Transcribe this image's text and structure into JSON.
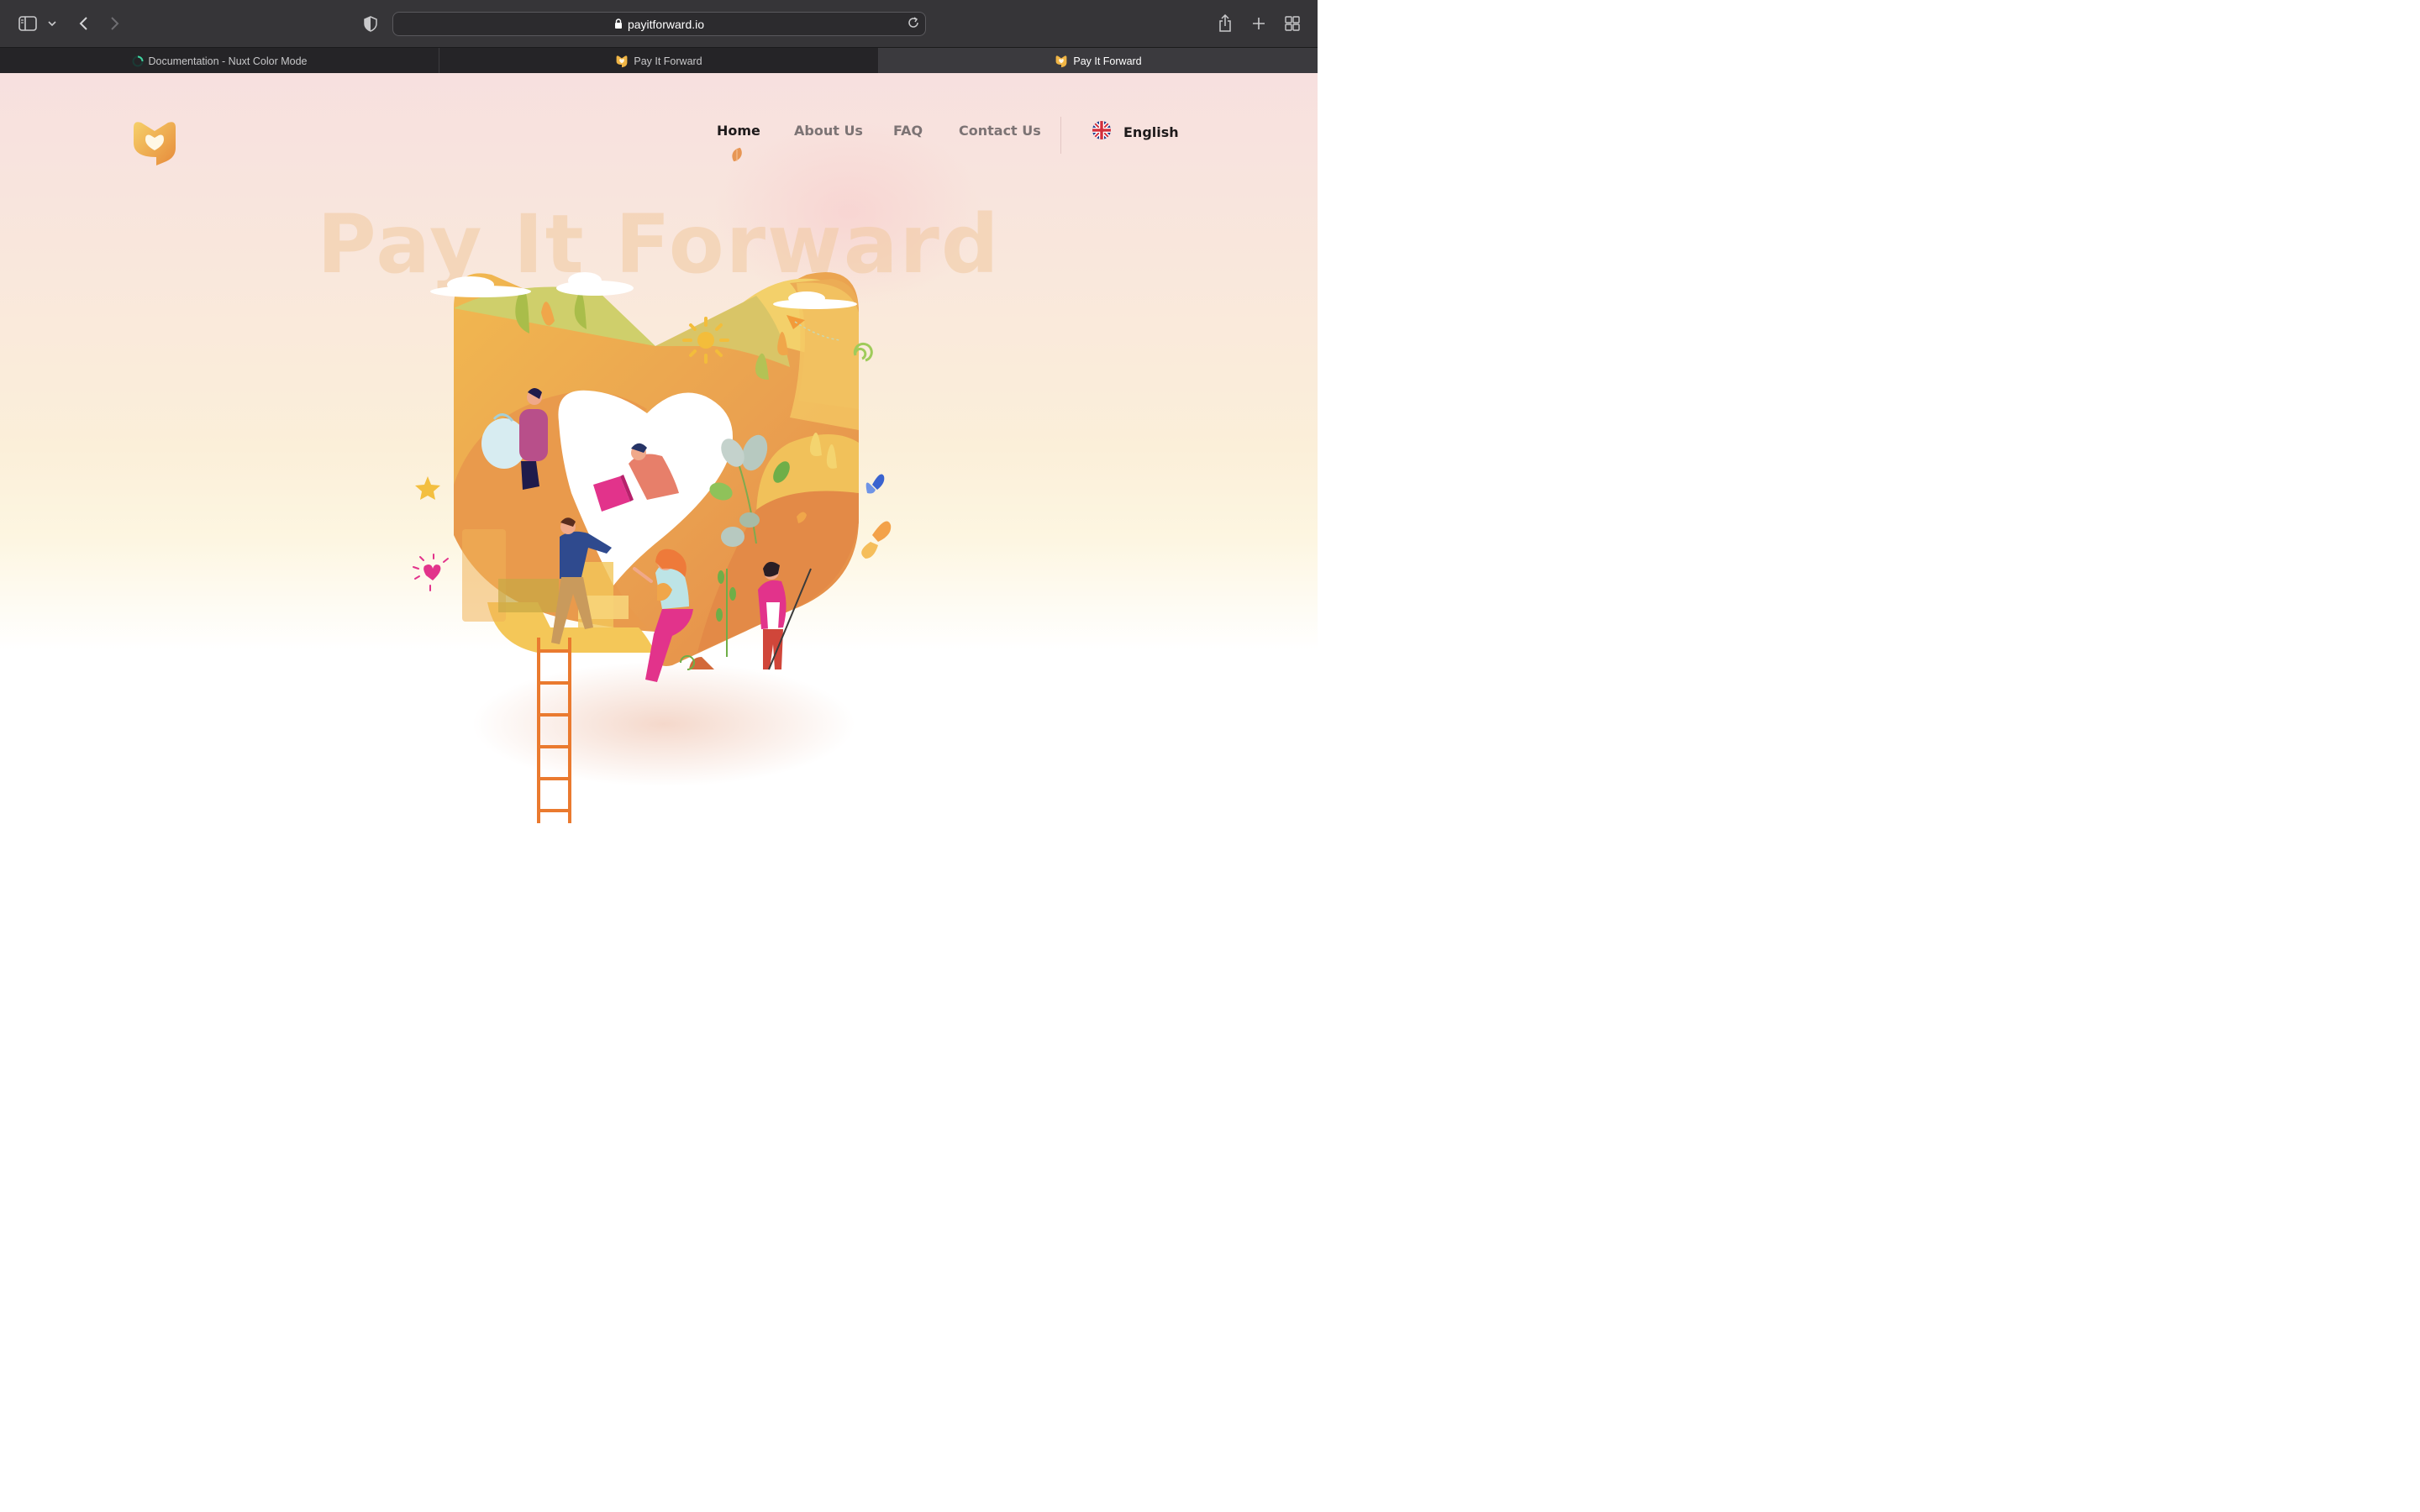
{
  "browser": {
    "url": "payitforward.io",
    "tabs": [
      {
        "title": "Documentation - Nuxt Color Mode",
        "active": false
      },
      {
        "title": "Pay It Forward",
        "active": false
      },
      {
        "title": "Pay It Forward",
        "active": true
      }
    ]
  },
  "header": {
    "nav": [
      {
        "label": "Home",
        "active": true
      },
      {
        "label": "About Us",
        "active": false
      },
      {
        "label": "FAQ",
        "active": false
      },
      {
        "label": "Contact Us",
        "active": false
      }
    ],
    "language": {
      "label": "English",
      "flag": "uk-flag-icon"
    }
  },
  "hero": {
    "title": "Pay It Forward"
  },
  "colors": {
    "brand_orange": "#e88a3c",
    "brand_yellow": "#f2c24d",
    "accent_pink": "#e0318b",
    "ladder": "#ea7a2f"
  }
}
